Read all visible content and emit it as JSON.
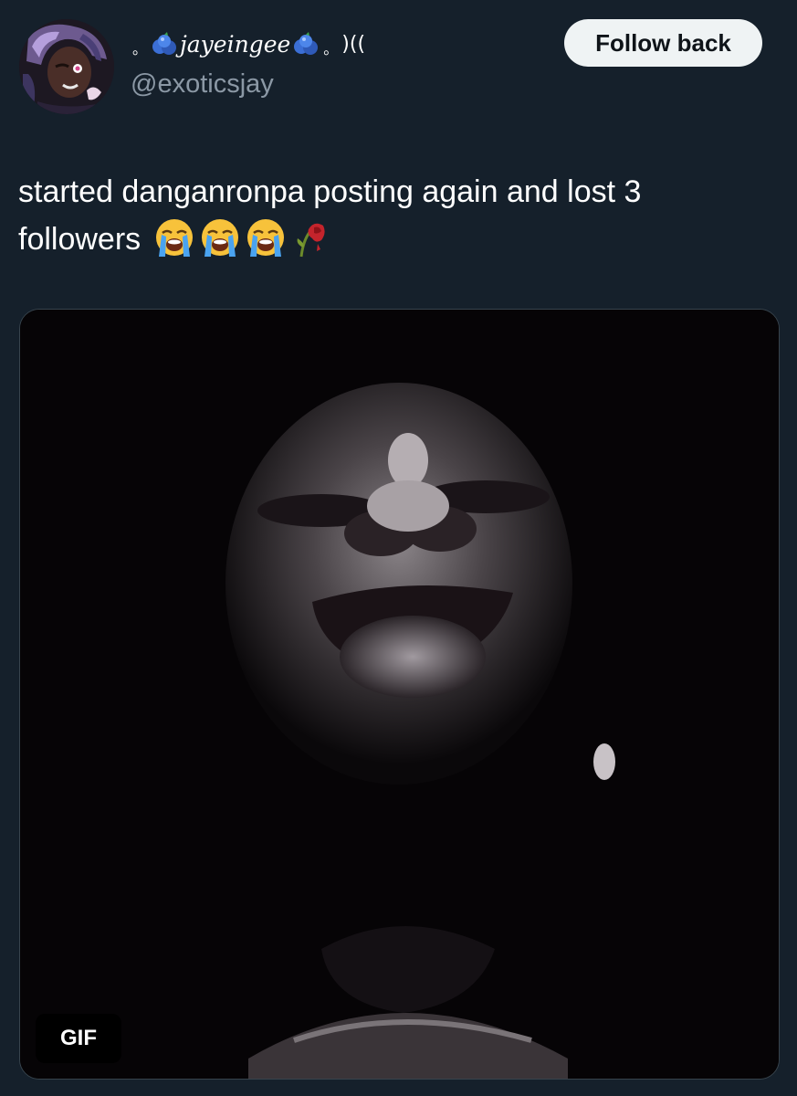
{
  "author": {
    "display_name_prefix": "。",
    "display_name": "jayeingee",
    "display_name_suffix": "。",
    "display_name_bracket": ")((",
    "blue_emoji_icon": "blueberries-icon",
    "handle": "@exoticsjay",
    "avatar_icon": "anime-avatar-icon"
  },
  "follow_button": {
    "label": "Follow back"
  },
  "tweet": {
    "text_line1": "started danganronpa posting again and lost 3",
    "text_line2": "followers",
    "emojis": [
      "loudly-crying-face-icon",
      "loudly-crying-face-icon",
      "loudly-crying-face-icon",
      "wilted-flower-icon"
    ]
  },
  "media": {
    "badge": "GIF",
    "content_icon": "crying-face-photo"
  },
  "colors": {
    "background": "#15202b",
    "secondary_text": "#8b98a5",
    "button_bg": "#eff3f4",
    "border": "#38444d"
  }
}
